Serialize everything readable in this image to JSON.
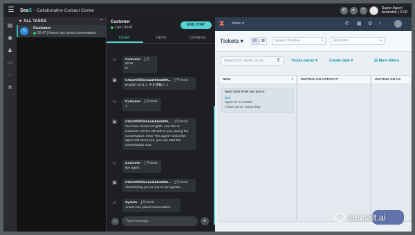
{
  "topbar": {
    "brand_prefix": "Sea",
    "brand_x": "X",
    "app_title": "- Collaborative Contact Center",
    "agent_name": "Super Agent",
    "agent_status": "Available | 2:20"
  },
  "tasks": {
    "header": "ALL TASKS",
    "items": [
      {
        "avatar": "✎",
        "name": "Customer",
        "timer": "00:47",
        "preview": "Anson has joined conversation."
      }
    ]
  },
  "chat": {
    "customer_name": "Customer",
    "status": "Live | 00:47",
    "end_button": "END CHAT",
    "tabs": [
      "CHAT",
      "INFO",
      "CONFIG"
    ],
    "messages": [
      {
        "sender": "Customer",
        "time": "上午09:58",
        "text": "hi"
      },
      {
        "sender": "CH2a70fbfd4e1a4eb6a3d99...",
        "time": "上午09:58",
        "text": "English send 1, 中文請輸入 2"
      },
      {
        "sender": "Customer",
        "time": "上午09:58",
        "text": "1"
      },
      {
        "sender": "CH2a70fbfd4e1a4eb6a3d99...",
        "time": "上午09:58",
        "text": "You have chosen English, now the AI customer service will talk to you, during the conversation, enter \"live agent\" and a live agent will serve you, you can start the conversation now."
      },
      {
        "sender": "Customer",
        "time": "上午09:59",
        "text": "live agent"
      },
      {
        "sender": "CH2a70fbfd4e1a4eb6a3d99...",
        "time": "上午09:59",
        "text": "Transferring you to one of our agents..."
      },
      {
        "sender": "System",
        "time": "上午09:59",
        "text": "Anson has joined conversation."
      }
    ],
    "composer_placeholder": "Type message"
  },
  "hubspot": {
    "menu": "Menu",
    "title": "Tickets",
    "pipeline": "Support Pipeline",
    "ticket_view": "All tickets",
    "search_placeholder": "Search ID, name, or su",
    "filter_owner": "Ticket owner",
    "filter_date": "Create date",
    "more_filters": "More filters",
    "columns": [
      {
        "name": "NEW",
        "count": "1"
      },
      {
        "name": "WAITING ON CONTACT",
        "count": ""
      },
      {
        "name": "WAITING ON US",
        "count": ""
      }
    ],
    "card": {
      "age": "INACTIVE FOR 167 DAYS",
      "name": "test",
      "open_for": "Open for 6 months",
      "owner": "Ticket owner: anson liao"
    }
  },
  "watermark": {
    "text": "seasalt.ai"
  }
}
